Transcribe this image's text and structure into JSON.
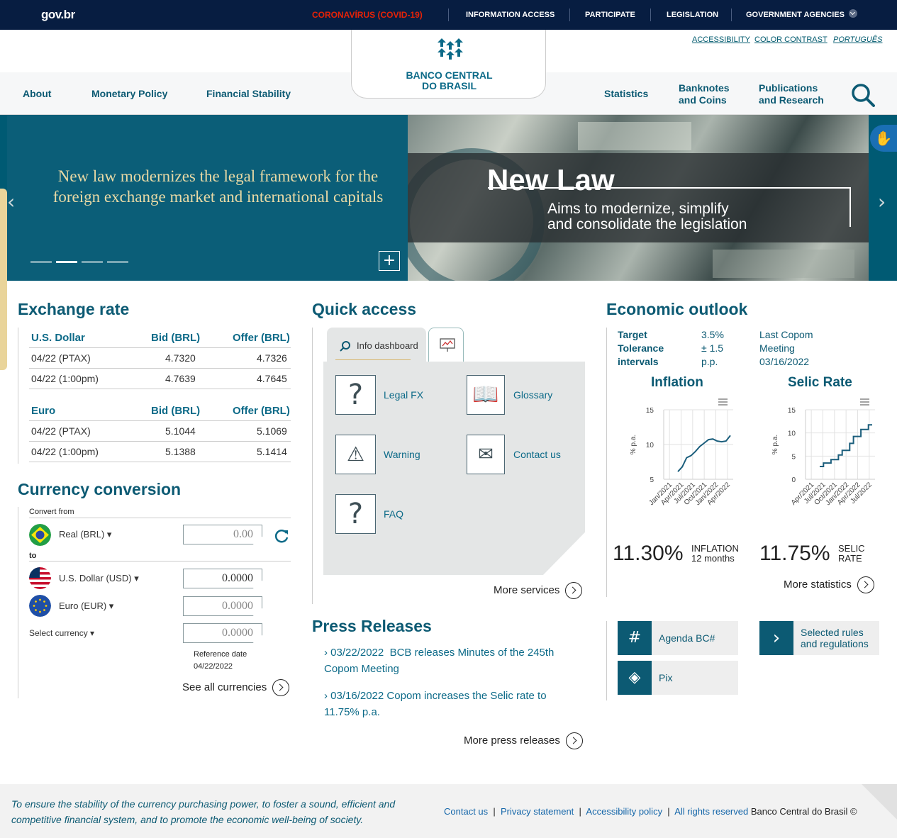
{
  "govbar": {
    "logo": "gov.br",
    "covid": "CORONAVÍRUS (COVID-19)",
    "links": [
      "INFORMATION ACCESS",
      "PARTICIPATE",
      "LEGISLATION",
      "GOVERNMENT AGENCIES"
    ]
  },
  "top_links": {
    "accessibility": "ACCESSIBILITY",
    "contrast": "COLOR CONTRAST",
    "language": "PORTUGUÊS"
  },
  "brand": {
    "line1": "BANCO CENTRAL",
    "line2": "DO BRASIL"
  },
  "nav": {
    "about": "About",
    "monetary": "Monetary Policy",
    "financial": "Financial Stability",
    "statistics": "Statistics",
    "banknotes1": "Banknotes",
    "banknotes2": "and Coins",
    "pubs1": "Publications",
    "pubs2": "and Research"
  },
  "hero": {
    "caption": "New law modernizes the legal framework for the foreign exchange market and international capitals",
    "title": "New Law",
    "sub1": "Aims to modernize, simplify",
    "sub2": "and consolidate the legislation",
    "plus": "+",
    "prev": "‹",
    "next": "›"
  },
  "exchange": {
    "title": "Exchange rate",
    "bid_header": "Bid (BRL)",
    "offer_header": "Offer (BRL)",
    "usd": {
      "name": "U.S. Dollar",
      "rows": [
        {
          "date": "04/22 (PTAX)",
          "bid": "4.7320",
          "offer": "4.7326"
        },
        {
          "date": "04/22 (1:00pm)",
          "bid": "4.7639",
          "offer": "4.7645"
        }
      ]
    },
    "eur": {
      "name": "Euro",
      "rows": [
        {
          "date": "04/22 (PTAX)",
          "bid": "5.1044",
          "offer": "5.1069"
        },
        {
          "date": "04/22 (1:00pm)",
          "bid": "5.1388",
          "offer": "5.1414"
        }
      ]
    }
  },
  "conversion": {
    "title": "Currency conversion",
    "convert_from": "Convert from",
    "to": "to",
    "from_currency": "Real (BRL)",
    "from_value": "0.00",
    "usd": "U.S. Dollar (USD)",
    "usd_value": "0.0000",
    "eur": "Euro (EUR)",
    "eur_value": "0.0000",
    "select": "Select currency",
    "select_value": "0.0000",
    "ref_label": "Reference date",
    "ref_date": "04/22/2022",
    "see_all": "See all currencies"
  },
  "quick": {
    "title": "Quick access",
    "tab": "Info dashboard",
    "items": [
      "Legal FX",
      "Glossary",
      "Warning",
      "Contact us",
      "FAQ"
    ],
    "more": "More services"
  },
  "press": {
    "title": "Press Releases",
    "items": [
      {
        "date": "03/22/2022",
        "text": "BCB releases Minutes of the 245th",
        "text2": "Copom Meeting"
      },
      {
        "date": "03/16/2022",
        "text": "Copom increases the Selic rate to",
        "text2": "11.75% p.a."
      }
    ],
    "more": "More press releases"
  },
  "economic": {
    "title": "Economic outlook",
    "target_label": [
      "Target",
      "Tolerance",
      "intervals"
    ],
    "target_value": [
      "3.5%",
      "± 1.5",
      "p.p."
    ],
    "copom": [
      "Last Copom",
      "Meeting",
      "03/16/2022"
    ],
    "inflation_title": "Inflation",
    "selic_title": "Selic Rate",
    "inflation_value": "11.30%",
    "inflation_label": "INFLATION",
    "inflation_sub": "12 months",
    "selic_value": "11.75%",
    "selic_label1": "SELIC",
    "selic_label2": "RATE",
    "more": "More statistics"
  },
  "chart_data": [
    {
      "type": "line",
      "title": "Inflation",
      "ylabel": "% p.a.",
      "ylim": [
        5,
        15
      ],
      "yticks": [
        "5",
        "10",
        "15"
      ],
      "xticks": [
        "Jan/2021",
        "Apr/2021",
        "Jul/2021",
        "Oct/2021",
        "Jan/2022",
        "Apr/2022"
      ],
      "series": [
        {
          "values": [
            6.1,
            6.8,
            8.1,
            8.4,
            9.0,
            9.7,
            10.2,
            10.7,
            10.8,
            10.5,
            10.4,
            10.5,
            11.3
          ]
        }
      ]
    },
    {
      "type": "line",
      "title": "Selic Rate",
      "ylabel": "% p.a.",
      "ylim": [
        0,
        15
      ],
      "yticks": [
        "0",
        "5",
        "10",
        "15"
      ],
      "xticks": [
        "Apr/2021",
        "Jul/2021",
        "Oct/2021",
        "Jan/2022",
        "Apr/2022",
        "Jul/2022"
      ],
      "series": [
        {
          "values": [
            2.75,
            3.5,
            3.5,
            4.25,
            4.25,
            5.25,
            6.25,
            6.25,
            7.75,
            9.25,
            9.25,
            10.75,
            10.75,
            11.75,
            11.75
          ]
        }
      ]
    }
  ],
  "tiles": {
    "agenda": "Agenda BC#",
    "pix": "Pix",
    "rules1": "Selected rules",
    "rules2": "and regulations"
  },
  "footer": {
    "mission1": "To ensure the stability of the currency purchasing power, to foster a sound, efficient and",
    "mission2": "competitive financial system, and to promote the economic well-being of society.",
    "contact": "Contact us",
    "privacy": "Privacy statement",
    "accessibility": "Accessibility policy",
    "rights": "All rights reserved",
    "owner": "Banco Central do Brasil ©"
  },
  "colors": {
    "gov_bar": "#071d41",
    "brand": "#0c5a73",
    "covid": "#e52207",
    "hero": "#005a73",
    "accent_gold": "#e8d9a5"
  }
}
